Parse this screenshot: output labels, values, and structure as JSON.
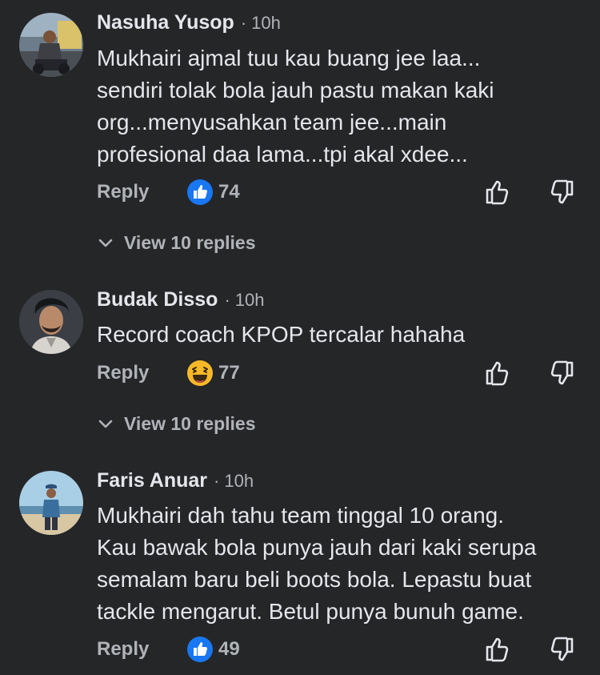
{
  "comments": [
    {
      "author": "Nasuha Yusop",
      "separator": "·",
      "time": "10h",
      "lines": [
        "Mukhairi ajmal tuu kau buang jee laa...",
        "sendiri tolak bola jauh pastu makan kaki",
        "org...menyusahkan team jee...main",
        "profesional daa lama...tpi akal xdee..."
      ],
      "reply_label": "Reply",
      "reaction_icon": "like-reaction-icon",
      "reaction_count": "74",
      "view_replies": "View 10 replies"
    },
    {
      "author": "Budak Disso",
      "separator": "·",
      "time": "10h",
      "lines": [
        "Record coach KPOP tercalar hahaha"
      ],
      "reply_label": "Reply",
      "reaction_icon": "haha-reaction-icon",
      "reaction_count": "77",
      "view_replies": "View 10 replies"
    },
    {
      "author": "Faris Anuar",
      "separator": "·",
      "time": "10h",
      "lines": [
        "Mukhairi dah tahu team tinggal 10 orang.",
        "Kau bawak bola punya jauh dari kaki serupa",
        "semalam baru beli boots bola. Lepastu buat",
        "tackle mengarut. Betul punya bunuh game."
      ],
      "reply_label": "Reply",
      "reaction_icon": "like-reaction-icon",
      "reaction_count": "49"
    }
  ],
  "colors": {
    "background": "#252628",
    "primary_text": "#e4e6eb",
    "secondary_text": "#b0b3b8",
    "like_blue": "#1877f2",
    "haha_yellow": "#f7b928"
  }
}
